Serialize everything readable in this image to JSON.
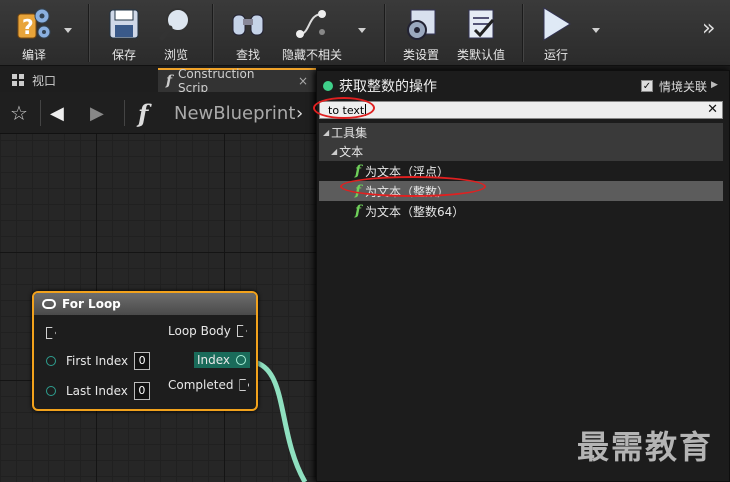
{
  "toolbar": {
    "compile_label": "编译",
    "save_label": "保存",
    "browse_label": "浏览",
    "find_label": "查找",
    "hide_unrelated_label": "隐藏不相关",
    "class_settings_label": "类设置",
    "class_defaults_label": "类默认值",
    "run_label": "运行",
    "overflow_glyph": "»"
  },
  "tabs": [
    {
      "label": "视口",
      "icon": "grid-icon"
    },
    {
      "label": "Construction Scrip",
      "icon": "function-icon",
      "close": "×"
    }
  ],
  "breadcrumb": {
    "star_glyph": "☆",
    "back_glyph": "◀",
    "forward_glyph": "▶",
    "function_glyph": "f",
    "title": "NewBlueprint",
    "chevron": "›"
  },
  "node": {
    "title": "For Loop",
    "outputs": [
      "Loop Body",
      "Index",
      "Completed"
    ],
    "inputs": [
      {
        "label": "First Index",
        "value": "0"
      },
      {
        "label": "Last Index",
        "value": "0"
      }
    ]
  },
  "popup": {
    "title": "获取整数的操作",
    "context_sensitive_label": "情境关联",
    "context_sensitive_checked": true,
    "search_value": "to text",
    "clear_glyph": "✕",
    "tree": {
      "category": "工具集",
      "subcategory": "文本",
      "items": [
        "为文本（浮点）",
        "为文本（整数）",
        "为文本（整数64）"
      ],
      "selected_index": 1
    }
  },
  "watermark": "最需教育",
  "colors": {
    "accent": "#f2a21c",
    "pin_teal": "#2e9e8f",
    "function_green": "#6fd05a",
    "highlight_red": "#e02020",
    "wire": "#8fe0c0"
  }
}
